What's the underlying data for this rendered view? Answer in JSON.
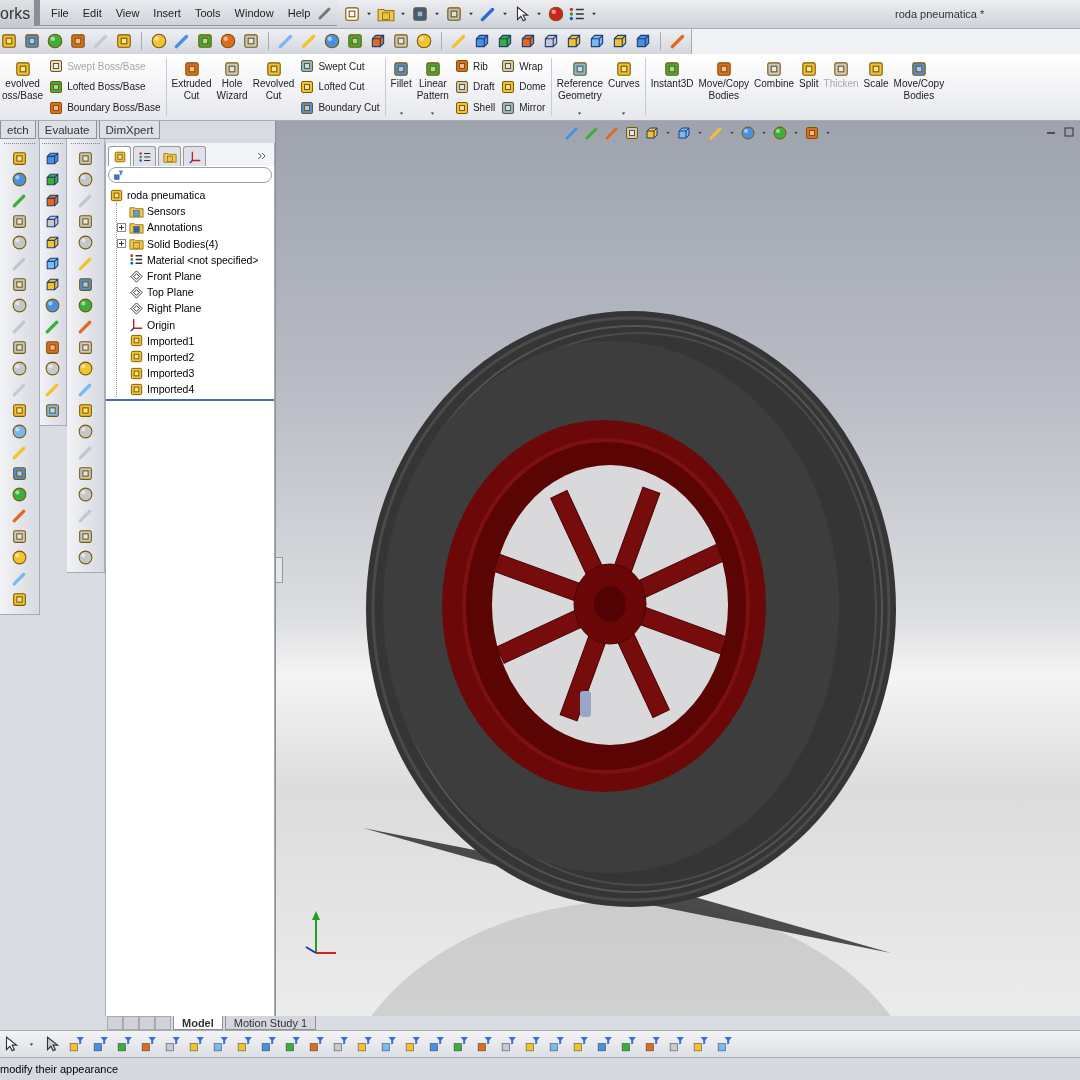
{
  "title_bar": {
    "logo_text": "orks",
    "menu": [
      "File",
      "Edit",
      "View",
      "Insert",
      "Tools",
      "Window",
      "Help"
    ],
    "document_title": "roda pneumatica *"
  },
  "command_manager": {
    "columns": [
      {
        "kind": "large",
        "label": "evolved\noss/Base",
        "disabled": false,
        "dropdown": false
      },
      {
        "kind": "stack",
        "items": [
          {
            "label": "Swept Boss/Base",
            "disabled": true
          },
          {
            "label": "Lofted Boss/Base",
            "disabled": false
          },
          {
            "label": "Boundary Boss/Base",
            "disabled": false
          }
        ]
      },
      {
        "kind": "separator"
      },
      {
        "kind": "large",
        "label": "Extruded\nCut",
        "disabled": false,
        "dropdown": false
      },
      {
        "kind": "large",
        "label": "Hole\nWizard",
        "disabled": false,
        "dropdown": false
      },
      {
        "kind": "large",
        "label": "Revolved\nCut",
        "disabled": false,
        "dropdown": false
      },
      {
        "kind": "stack",
        "items": [
          {
            "label": "Swept Cut",
            "disabled": false
          },
          {
            "label": "Lofted Cut",
            "disabled": false
          },
          {
            "label": "Boundary Cut",
            "disabled": false
          }
        ]
      },
      {
        "kind": "separator"
      },
      {
        "kind": "large",
        "label": "Fillet",
        "disabled": false,
        "dropdown": true
      },
      {
        "kind": "large",
        "label": "Linear\nPattern",
        "disabled": false,
        "dropdown": true
      },
      {
        "kind": "stack",
        "items": [
          {
            "label": "Rib",
            "disabled": false
          },
          {
            "label": "Draft",
            "disabled": false
          },
          {
            "label": "Shell",
            "disabled": false
          }
        ]
      },
      {
        "kind": "stack",
        "items": [
          {
            "label": "Wrap",
            "disabled": false
          },
          {
            "label": "Dome",
            "disabled": false
          },
          {
            "label": "Mirror",
            "disabled": false
          }
        ]
      },
      {
        "kind": "separator"
      },
      {
        "kind": "large",
        "label": "Reference\nGeometry",
        "disabled": false,
        "dropdown": true
      },
      {
        "kind": "large",
        "label": "Curves",
        "disabled": false,
        "dropdown": true
      },
      {
        "kind": "separator"
      },
      {
        "kind": "large",
        "label": "Instant3D",
        "disabled": false,
        "dropdown": false
      },
      {
        "kind": "large",
        "label": "Move/Copy\nBodies",
        "disabled": false,
        "dropdown": false
      },
      {
        "kind": "large",
        "label": "Combine",
        "disabled": false,
        "dropdown": false
      },
      {
        "kind": "large",
        "label": "Split",
        "disabled": false,
        "dropdown": false
      },
      {
        "kind": "large",
        "label": "Thicken",
        "disabled": true,
        "dropdown": false
      },
      {
        "kind": "large",
        "label": "Scale",
        "disabled": false,
        "dropdown": false
      },
      {
        "kind": "large",
        "label": "Move/Copy\nBodies",
        "disabled": false,
        "dropdown": false
      }
    ]
  },
  "tabs": [
    {
      "label": "etch",
      "selected": false
    },
    {
      "label": "Evaluate",
      "selected": false
    },
    {
      "label": "DimXpert",
      "selected": false
    }
  ],
  "feature_tree": {
    "panel_tabs": [
      {
        "selected": true
      },
      {
        "selected": false
      },
      {
        "selected": false
      },
      {
        "selected": false
      }
    ],
    "root": "roda pneumatica",
    "items": [
      {
        "label": "Sensors",
        "kind": "sensors",
        "has_children": false
      },
      {
        "label": "Annotations",
        "kind": "annotations",
        "has_children": true
      },
      {
        "label": "Solid Bodies(4)",
        "kind": "bodies",
        "has_children": true
      },
      {
        "label": "Material <not specified>",
        "kind": "material",
        "has_children": false
      },
      {
        "label": "Front Plane",
        "kind": "plane",
        "has_children": false
      },
      {
        "label": "Top Plane",
        "kind": "plane",
        "has_children": false
      },
      {
        "label": "Right Plane",
        "kind": "plane",
        "has_children": false
      },
      {
        "label": "Origin",
        "kind": "origin",
        "has_children": false
      },
      {
        "label": "Imported1",
        "kind": "body",
        "has_children": false
      },
      {
        "label": "Imported2",
        "kind": "body",
        "has_children": false
      },
      {
        "label": "Imported3",
        "kind": "body",
        "has_children": false
      },
      {
        "label": "Imported4",
        "kind": "body",
        "has_children": false
      }
    ]
  },
  "bottom_tabs": [
    {
      "label": "Model",
      "selected": true
    },
    {
      "label": "Motion Study 1",
      "selected": false
    }
  ],
  "status_bar": {
    "text": "modify their appearance"
  }
}
